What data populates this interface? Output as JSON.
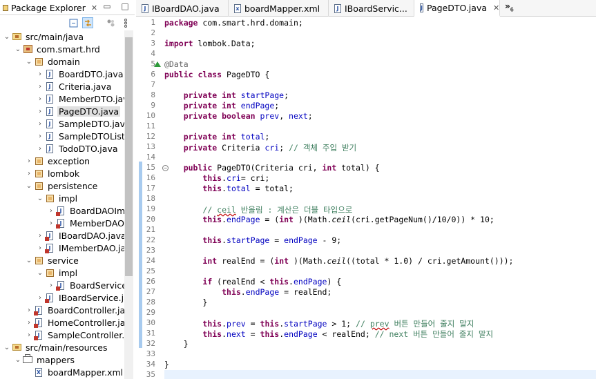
{
  "explorer": {
    "title": "Package Explorer",
    "toolbar": [
      "collapse-all-icon",
      "link-with-editor-icon",
      "filter-icon",
      "view-menu-icon"
    ],
    "tree": [
      {
        "depth": 0,
        "chev": "open",
        "icon": "source-folder",
        "label": "src/main/java"
      },
      {
        "depth": 1,
        "chev": "open",
        "icon": "package-root",
        "label": "com.smart.hrd"
      },
      {
        "depth": 2,
        "chev": "open",
        "icon": "package",
        "label": "domain"
      },
      {
        "depth": 3,
        "chev": "closed",
        "icon": "java",
        "label": "BoardDTO.java"
      },
      {
        "depth": 3,
        "chev": "closed",
        "icon": "java",
        "label": "Criteria.java"
      },
      {
        "depth": 3,
        "chev": "closed",
        "icon": "java",
        "label": "MemberDTO.jav"
      },
      {
        "depth": 3,
        "chev": "closed",
        "icon": "java",
        "label": "PageDTO.java",
        "selected": true
      },
      {
        "depth": 3,
        "chev": "closed",
        "icon": "java",
        "label": "SampleDTO.java"
      },
      {
        "depth": 3,
        "chev": "closed",
        "icon": "java",
        "label": "SampleDTOList.j"
      },
      {
        "depth": 3,
        "chev": "closed",
        "icon": "java",
        "label": "TodoDTO.java"
      },
      {
        "depth": 2,
        "chev": "closed",
        "icon": "package",
        "label": "exception"
      },
      {
        "depth": 2,
        "chev": "closed",
        "icon": "package",
        "label": "lombok"
      },
      {
        "depth": 2,
        "chev": "open",
        "icon": "package",
        "label": "persistence"
      },
      {
        "depth": 3,
        "chev": "open",
        "icon": "package",
        "label": "impl"
      },
      {
        "depth": 4,
        "chev": "closed",
        "icon": "java-err",
        "label": "BoardDAOIm"
      },
      {
        "depth": 4,
        "chev": "closed",
        "icon": "java-err",
        "label": "MemberDAO"
      },
      {
        "depth": 3,
        "chev": "closed",
        "icon": "java-err",
        "label": "IBoardDAO.java"
      },
      {
        "depth": 3,
        "chev": "closed",
        "icon": "java-err",
        "label": "IMemberDAO.ja"
      },
      {
        "depth": 2,
        "chev": "open",
        "icon": "package",
        "label": "service"
      },
      {
        "depth": 3,
        "chev": "open",
        "icon": "package",
        "label": "impl"
      },
      {
        "depth": 4,
        "chev": "closed",
        "icon": "java-err",
        "label": "BoardServiceI"
      },
      {
        "depth": 3,
        "chev": "closed",
        "icon": "java-err",
        "label": "IBoardService.jav"
      },
      {
        "depth": 2,
        "chev": "closed",
        "icon": "java-err",
        "label": "BoardController.jav"
      },
      {
        "depth": 2,
        "chev": "closed",
        "icon": "java-err",
        "label": "HomeController.jav"
      },
      {
        "depth": 2,
        "chev": "closed",
        "icon": "java-err",
        "label": "SampleController.ja"
      },
      {
        "depth": 0,
        "chev": "open",
        "icon": "source-folder",
        "label": "src/main/resources"
      },
      {
        "depth": 1,
        "chev": "open",
        "icon": "folder",
        "label": "mappers"
      },
      {
        "depth": 2,
        "chev": "none",
        "icon": "xml",
        "label": "boardMapper.xml"
      }
    ]
  },
  "editor": {
    "tabs": [
      {
        "label": "IBoardDAO.java",
        "icon": "java-file-icon",
        "active": false
      },
      {
        "label": "boardMapper.xml",
        "icon": "xml-file-icon",
        "active": false
      },
      {
        "label": "IBoardServic...",
        "icon": "java-file-icon",
        "active": false
      },
      {
        "label": "PageDTO.java",
        "icon": "java-file-icon",
        "active": true
      }
    ],
    "more_tabs": "»",
    "more_count": "6",
    "line_numbers": [
      "1",
      "2",
      "3",
      "4",
      "5",
      "6",
      "7",
      "8",
      "9",
      "10",
      "11",
      "12",
      "13",
      "14",
      "15",
      "16",
      "17",
      "18",
      "19",
      "20",
      "21",
      "22",
      "23",
      "24",
      "25",
      "26",
      "27",
      "28",
      "29",
      "30",
      "31",
      "32",
      "33",
      "34",
      "35"
    ],
    "current_line": 35,
    "lines": [
      [
        [
          "kw",
          "package"
        ],
        [
          "",
          "com.smart.hrd.domain;"
        ]
      ],
      [],
      [
        [
          "kw",
          "import"
        ],
        [
          "",
          "lombok.Data;"
        ]
      ],
      [],
      [
        [
          "ann",
          "@Data"
        ]
      ],
      [
        [
          "kw",
          "public"
        ],
        [
          "",
          ""
        ],
        [
          "kw",
          "class"
        ],
        [
          "",
          "PageDTO {"
        ]
      ],
      [],
      [
        [
          "",
          "    "
        ],
        [
          "kw",
          "private"
        ],
        [
          "",
          ""
        ],
        [
          "kw",
          "int"
        ],
        [
          "",
          ""
        ],
        [
          "fld",
          "startPage"
        ],
        [
          "",
          ";"
        ]
      ],
      [
        [
          "",
          "    "
        ],
        [
          "kw",
          "private"
        ],
        [
          "",
          ""
        ],
        [
          "kw",
          "int"
        ],
        [
          "",
          ""
        ],
        [
          "fld",
          "endPage"
        ],
        [
          "",
          ";"
        ]
      ],
      [
        [
          "",
          "    "
        ],
        [
          "kw",
          "private"
        ],
        [
          "",
          ""
        ],
        [
          "kw",
          "boolean"
        ],
        [
          "",
          ""
        ],
        [
          "fld",
          "prev"
        ],
        [
          "",
          ", "
        ],
        [
          "fld",
          "next"
        ],
        [
          "",
          ";"
        ]
      ],
      [],
      [
        [
          "",
          "    "
        ],
        [
          "kw",
          "private"
        ],
        [
          "",
          ""
        ],
        [
          "kw",
          "int"
        ],
        [
          "",
          ""
        ],
        [
          "fld",
          "total"
        ],
        [
          "",
          ";"
        ]
      ],
      [
        [
          "",
          "    "
        ],
        [
          "kw",
          "private"
        ],
        [
          "",
          "Criteria "
        ],
        [
          "fld",
          "cri"
        ],
        [
          "",
          "; "
        ],
        [
          "cmt",
          "// 객체 주입 받기"
        ]
      ],
      [],
      [
        [
          "",
          "    "
        ],
        [
          "kw",
          "public"
        ],
        [
          "",
          "PageDTO(Criteria cri, "
        ],
        [
          "kw",
          "int"
        ],
        [
          "",
          "total) {"
        ]
      ],
      [
        [
          "",
          "        "
        ],
        [
          "kw",
          "this"
        ],
        [
          "",
          "."
        ],
        [
          "fld",
          "cri"
        ],
        [
          "",
          ""
        ],
        [
          "",
          "= cri;"
        ]
      ],
      [
        [
          "",
          "        "
        ],
        [
          "kw",
          "this"
        ],
        [
          "",
          "."
        ],
        [
          "fld",
          "total"
        ],
        [
          "",
          "= total;"
        ]
      ],
      [],
      [
        [
          "",
          "        "
        ],
        [
          "cmt",
          "// "
        ],
        [
          "cmt sq",
          "ceil"
        ],
        [
          "cmt",
          " 반올림 : 계산은 더블 타입으로"
        ]
      ],
      [
        [
          "",
          "        "
        ],
        [
          "kw",
          "this"
        ],
        [
          "",
          "."
        ],
        [
          "fld",
          "endPage"
        ],
        [
          "",
          "= ("
        ],
        [
          "kw",
          "int"
        ],
        [
          "",
          ")(Math."
        ],
        [
          "it",
          "ceil"
        ],
        [
          "",
          "(cri.getPageNum()/10/0)) * 10;"
        ]
      ],
      [],
      [
        [
          "",
          "        "
        ],
        [
          "kw",
          "this"
        ],
        [
          "",
          "."
        ],
        [
          "fld",
          "startPage"
        ],
        [
          "",
          "= "
        ],
        [
          "fld",
          "endPage"
        ],
        [
          "",
          "- 9;"
        ]
      ],
      [],
      [
        [
          "",
          "        "
        ],
        [
          "kw",
          "int"
        ],
        [
          "",
          "realEnd = ("
        ],
        [
          "kw",
          "int"
        ],
        [
          "",
          ")(Math."
        ],
        [
          "it",
          "ceil"
        ],
        [
          "",
          "((total * 1.0) / cri.getAmount()));"
        ]
      ],
      [],
      [
        [
          "",
          "        "
        ],
        [
          "kw",
          "if"
        ],
        [
          "",
          "(realEnd < "
        ],
        [
          "kw",
          "this"
        ],
        [
          "",
          "."
        ],
        [
          "fld",
          "endPage"
        ],
        [
          "",
          ") {"
        ]
      ],
      [
        [
          "",
          "            "
        ],
        [
          "kw",
          "this"
        ],
        [
          "",
          "."
        ],
        [
          "fld",
          "endPage"
        ],
        [
          "",
          "= realEnd;"
        ]
      ],
      [
        [
          "",
          "        }"
        ]
      ],
      [],
      [
        [
          "",
          "        "
        ],
        [
          "kw",
          "this"
        ],
        [
          "",
          "."
        ],
        [
          "fld",
          "prev"
        ],
        [
          "",
          "= "
        ],
        [
          "kw",
          "this"
        ],
        [
          "",
          "."
        ],
        [
          "fld",
          "startPage"
        ],
        [
          "",
          "> 1; "
        ],
        [
          "cmt",
          "// "
        ],
        [
          "cmt sq",
          "prev"
        ],
        [
          "cmt",
          " 버튼 만들어 줄지 말지"
        ]
      ],
      [
        [
          "",
          "        "
        ],
        [
          "kw",
          "this"
        ],
        [
          "",
          "."
        ],
        [
          "fld",
          "next"
        ],
        [
          "",
          "= "
        ],
        [
          "kw",
          "this"
        ],
        [
          "",
          "."
        ],
        [
          "fld",
          "endPage"
        ],
        [
          "",
          "< realEnd; "
        ],
        [
          "cmt",
          "// next 버튼 만들어 줄지 말지"
        ]
      ],
      [
        [
          "",
          "    }"
        ]
      ],
      [],
      [
        [
          "",
          "}"
        ]
      ],
      []
    ]
  }
}
